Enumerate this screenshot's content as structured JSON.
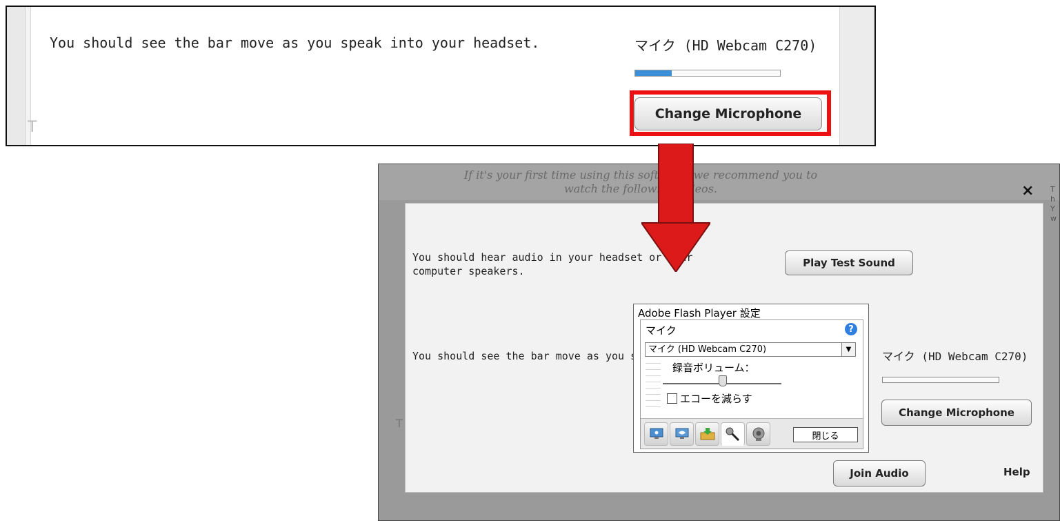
{
  "top_crop": {
    "hint": "You should see the bar move as you speak into your headset.",
    "microphone_label": "マイク (HD Webcam C270)",
    "level_percent": 25,
    "change_button": "Change Microphone",
    "highlight_color": "#ee1111"
  },
  "arrow": {
    "color": "#dd1a1a",
    "icon": "arrow-down"
  },
  "bottom_crop": {
    "background": {
      "intro": "If it's your first time using this software, we recommend you to watch the following videos.",
      "close_glyph": "×"
    },
    "dialog": {
      "hear_text": "You should hear audio in your headset or your computer speakers.",
      "play_button": "Play Test Sound",
      "see_text": "You should see the bar move as you speak into your headset.",
      "microphone_label": "マイク (HD Webcam C270)",
      "level_percent": 0,
      "change_button": "Change Microphone",
      "join_button": "Join Audio",
      "help_link": "Help"
    },
    "flash_settings": {
      "title": "Adobe Flash Player 設定",
      "section": "マイク",
      "selected_mic": "マイク (HD Webcam C270)",
      "volume_label": "録音ボリューム：",
      "volume_level": 0.5,
      "echo_label": "エコーを減らす",
      "echo_checked": false,
      "close_button": "閉じる",
      "tabs": [
        "privacy-icon",
        "display-icon",
        "storage-icon",
        "microphone-icon",
        "camera-icon"
      ],
      "active_tab": "microphone-icon"
    }
  }
}
